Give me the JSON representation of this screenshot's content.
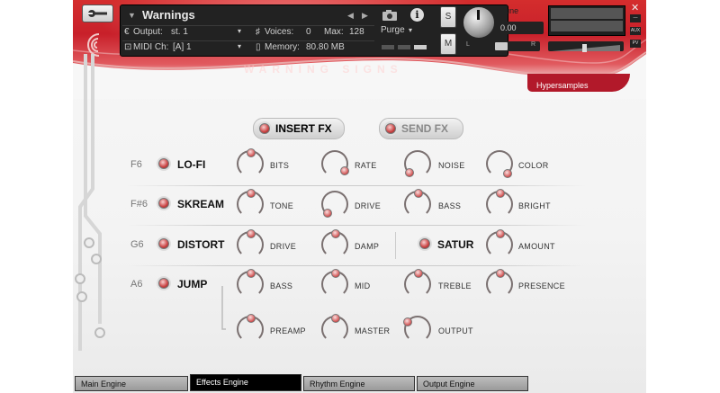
{
  "header": {
    "instrument_name": "Warnings",
    "output_label": "Output:",
    "output_value": "st. 1",
    "voices_label": "Voices:",
    "voices_value": "0",
    "max_label": "Max:",
    "max_value": "128",
    "midi_label": "MIDI Ch:",
    "midi_value": "[A]  1",
    "memory_label": "Memory:",
    "memory_value": "80.80 MB",
    "purge_label": "Purge",
    "solo_label": "S",
    "mute_label": "M",
    "tune_label": "Tune",
    "tune_value": "0.00",
    "pan_left": "L",
    "pan_right": "R",
    "aux_label": "AUX",
    "pv_label": "PV"
  },
  "title_banner": "WARNING SIGNS",
  "brand": "Hypersamples",
  "fx_routing": {
    "insert_label": "INSERT FX",
    "send_label": "SEND FX"
  },
  "effects": [
    {
      "key": "F6",
      "name": "LO-FI",
      "params": [
        "BITS",
        "RATE",
        "NOISE",
        "COLOR"
      ]
    },
    {
      "key": "F#6",
      "name": "SKREAM",
      "params": [
        "TONE",
        "DRIVE",
        "BASS",
        "BRIGHT"
      ]
    },
    {
      "key": "G6",
      "name": "DISTORT",
      "params": [
        "DRIVE",
        "DAMP"
      ]
    },
    {
      "key": "A6",
      "name": "JUMP",
      "params": [
        "BASS",
        "MID",
        "TREBLE",
        "PRESENCE",
        "PREAMP",
        "MASTER",
        "OUTPUT"
      ]
    }
  ],
  "satur": {
    "name": "SATUR",
    "params": [
      "AMOUNT"
    ]
  },
  "tabs": [
    "Main Engine",
    "Effects Engine",
    "Rhythm Engine",
    "Output Engine"
  ],
  "active_tab": "Effects Engine",
  "colors": {
    "accent": "#c8202a",
    "panel": "#222222",
    "led": "#c94040"
  }
}
